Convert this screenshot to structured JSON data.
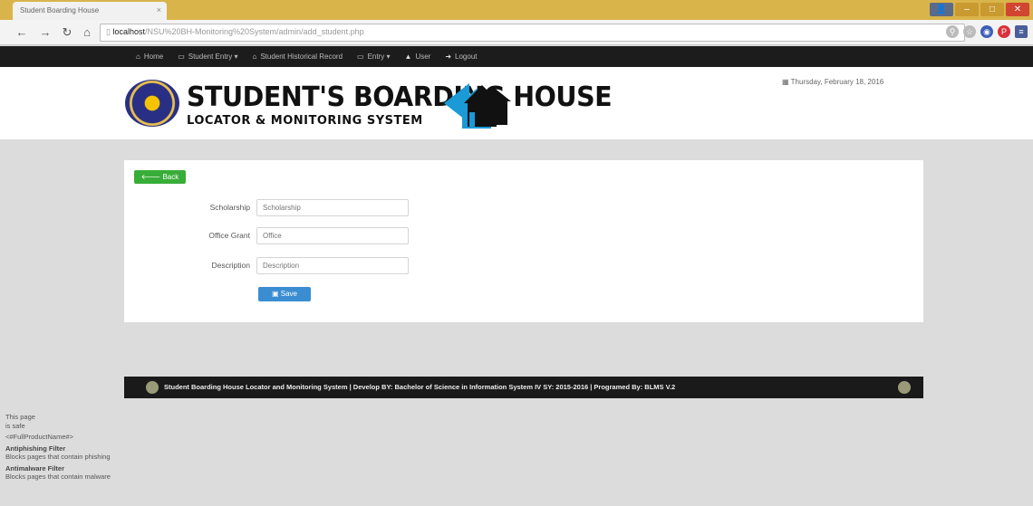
{
  "browser": {
    "tab_title": "Student Boarding House",
    "tab_close": "×",
    "url_host": "localhost",
    "url_path": "/NSU%20BH-Monitoring%20System/admin/add_student.php",
    "win_min": "–",
    "win_max": "□",
    "win_close": "✕"
  },
  "nav": {
    "items": [
      {
        "icon": "home-icon",
        "glyph": "⌂",
        "label": "Home"
      },
      {
        "icon": "folder-icon",
        "glyph": "▭",
        "label": "Student Entry ▾"
      },
      {
        "icon": "home-icon",
        "glyph": "⌂",
        "label": "Student Historical Record"
      },
      {
        "icon": "folder-icon",
        "glyph": "▭",
        "label": "Entry ▾"
      },
      {
        "icon": "user-icon",
        "glyph": "▲",
        "label": "User"
      },
      {
        "icon": "logout-icon",
        "glyph": "➜",
        "label": "Logout"
      }
    ]
  },
  "header": {
    "logo_title": "STUDENT'S BOARDING HOUSE",
    "logo_subtitle": "LOCATOR & MONITORING SYSTEM",
    "date_icon": "▦",
    "date": "Thursday, February 18, 2016"
  },
  "form": {
    "back_label": "Back",
    "fields": [
      {
        "label": "Scholarship",
        "placeholder": "Scholarship"
      },
      {
        "label": "Office Grant",
        "placeholder": "Office"
      },
      {
        "label": "Description",
        "placeholder": "Description"
      }
    ],
    "save_label": "Save"
  },
  "footer": {
    "text": "Student Boarding House Locator and Monitoring System  |  Develop BY: Bachelor of Science in Information System IV SY: 2015-2016  |  Programed By: BLMS V.2"
  },
  "security": {
    "line1": "This page",
    "line2": "is safe",
    "line3": "<#FullProductName#>",
    "filter1_title": "Antiphishing Filter",
    "filter1_desc": "Blocks pages that contain phishing",
    "filter2_title": "Antimalware Filter",
    "filter2_desc": "Blocks pages that contain malware"
  },
  "colors": {
    "tabstrip": "#d9b44a",
    "navbar": "#1c1c1c",
    "back_button": "#38ad38",
    "save_button": "#3a8dd0",
    "footer": "#1a1a1a"
  }
}
